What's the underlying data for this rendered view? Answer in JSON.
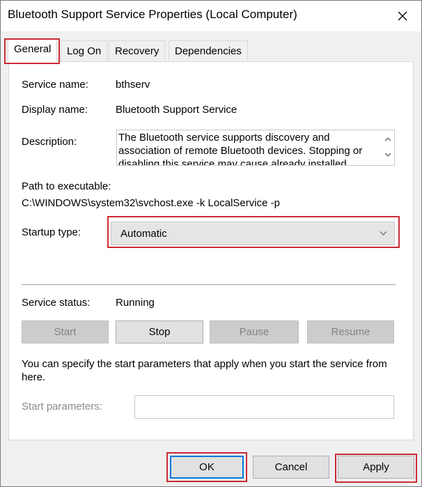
{
  "window": {
    "title": "Bluetooth Support Service Properties (Local Computer)"
  },
  "tabs": [
    {
      "label": "General",
      "active": true
    },
    {
      "label": "Log On",
      "active": false
    },
    {
      "label": "Recovery",
      "active": false
    },
    {
      "label": "Dependencies",
      "active": false
    }
  ],
  "general": {
    "service_name_label": "Service name:",
    "service_name": "bthserv",
    "display_name_label": "Display name:",
    "display_name": "Bluetooth Support Service",
    "description_label": "Description:",
    "description": "The Bluetooth service supports discovery and association of remote Bluetooth devices.  Stopping or disabling this service may cause already installed",
    "path_label": "Path to executable:",
    "path": "C:\\WINDOWS\\system32\\svchost.exe -k LocalService -p",
    "startup_type_label": "Startup type:",
    "startup_type": "Automatic",
    "service_status_label": "Service status:",
    "service_status": "Running",
    "help_text": "You can specify the start parameters that apply when you start the service from here.",
    "start_params_label": "Start parameters:",
    "start_params_value": ""
  },
  "service_buttons": {
    "start": "Start",
    "stop": "Stop",
    "pause": "Pause",
    "resume": "Resume"
  },
  "dialog_buttons": {
    "ok": "OK",
    "cancel": "Cancel",
    "apply": "Apply"
  },
  "colors": {
    "highlight_box": "#cc2a36",
    "focus_border": "#0078d7"
  },
  "icons": {
    "close": "close-icon",
    "dropdown": "chevron-down-icon",
    "scroll_up": "chevron-up-icon",
    "scroll_down": "chevron-down-icon"
  }
}
